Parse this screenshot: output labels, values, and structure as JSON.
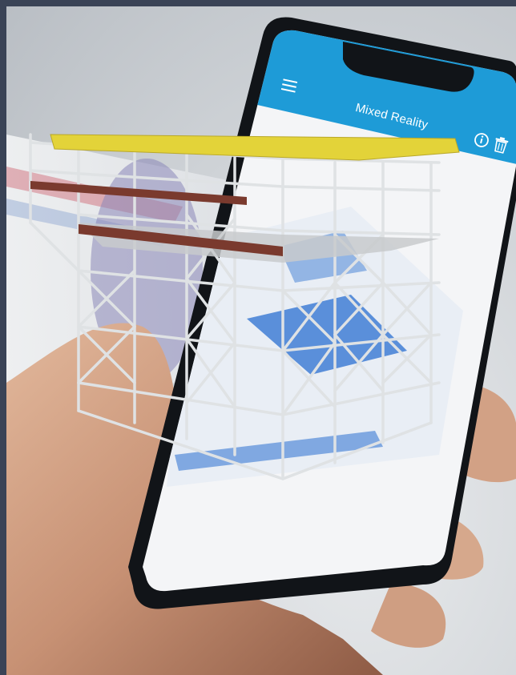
{
  "app": {
    "title": "Mixed Reality",
    "toolbar": {
      "menu_icon": "hamburger-menu-icon",
      "info_icon": "info-icon",
      "trash_icon": "trash-icon"
    }
  },
  "colors": {
    "background": "#3a4356",
    "app_bar": "#1e9bd7",
    "scaffold_tube": "#dfe2e4",
    "beam_yellow": "#e3d339",
    "beam_red": "#7a3a2e",
    "deck_gray": "#c8cacc",
    "blueprint_blue": "#2a6fd0"
  }
}
